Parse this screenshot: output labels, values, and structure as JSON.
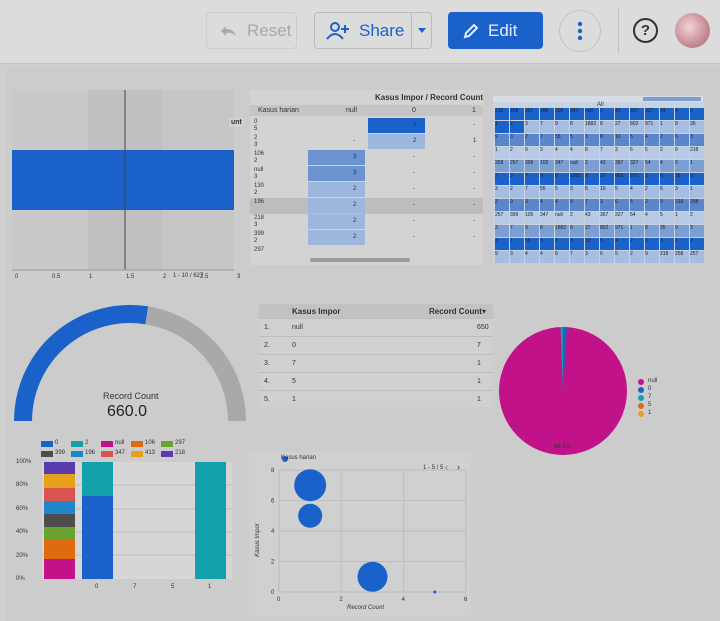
{
  "toolbar": {
    "reset_label": "Reset",
    "share_label": "Share",
    "edit_label": "Edit",
    "help_glyph": "?"
  },
  "colors": {
    "primary_blue": "#1a62c9",
    "magenta": "#c2128a",
    "teal": "#13a0ab",
    "grey_track": "#a9a9a9"
  },
  "icons": [
    "reset-icon",
    "add-person-icon",
    "dropdown-caret-icon",
    "pencil-icon",
    "more-vert-icon",
    "help-icon",
    "avatar"
  ],
  "pivot": {
    "title": "Kasus Impor / Record Count",
    "row_header": "Kasus harian",
    "col_headers": [
      "null",
      "0",
      "1"
    ],
    "rows": [
      {
        "label": "0",
        "sub": "5",
        "vals": [
          "",
          "3",
          "-"
        ]
      },
      {
        "label": "2",
        "sub": "3",
        "vals": [
          "-",
          "2",
          "1"
        ]
      },
      {
        "label": "106",
        "sub": "2",
        "vals": [
          "3",
          "-",
          "-"
        ]
      },
      {
        "label": "null",
        "sub": "3",
        "vals": [
          "3",
          "-",
          "-"
        ]
      },
      {
        "label": "130",
        "sub": "2",
        "vals": [
          "2",
          "-",
          "-"
        ]
      },
      {
        "label": "196",
        "sub": "",
        "vals": [
          "2",
          "-",
          "-"
        ]
      },
      {
        "label": "218",
        "sub": "3",
        "vals": [
          "2",
          "-",
          "-"
        ]
      },
      {
        "label": "399",
        "sub": "2",
        "vals": [
          "2",
          "-",
          "-"
        ]
      },
      {
        "label": "297",
        "sub": "",
        "vals": [
          "",
          "",
          ""
        ]
      }
    ]
  },
  "bar_panel": {
    "side_label": "unt",
    "axis_ticks": [
      "0",
      "0.5",
      "1",
      "1.5",
      "2",
      "2.5",
      "3"
    ],
    "pager": "1 - 10 / 627"
  },
  "treemap": {
    "title": "All",
    "labels": [
      "218",
      "258",
      "257",
      "399",
      "105",
      "347",
      "null",
      "2",
      "43",
      "367",
      "327",
      "54",
      "4",
      "5",
      "1",
      "2",
      "3",
      "7",
      "9",
      "8",
      "1882",
      "8",
      "27",
      "802",
      "971",
      "1",
      "8",
      "35",
      "9",
      "3",
      "2",
      "7",
      "55",
      "5",
      "3",
      "8",
      "10",
      "5",
      "4",
      "2",
      "6",
      "3",
      "1",
      "2",
      "9",
      "3",
      "4",
      "4",
      "8",
      "7",
      "3",
      "6",
      "5",
      "2",
      "9"
    ]
  },
  "gauge": {
    "label": "Record Count",
    "value": "660.0",
    "fraction": 0.55
  },
  "table": {
    "headers": [
      "Kasus Impor",
      "Record Count"
    ],
    "sort_marker": "▾",
    "rows": [
      {
        "idx": "1.",
        "name": "null",
        "count": "650"
      },
      {
        "idx": "2.",
        "name": "0",
        "count": "7"
      },
      {
        "idx": "3.",
        "name": "7",
        "count": "1"
      },
      {
        "idx": "4.",
        "name": "5",
        "count": "1"
      },
      {
        "idx": "5.",
        "name": "1",
        "count": "1"
      }
    ]
  },
  "pie": {
    "label": "98.5%",
    "legend": [
      {
        "label": "null",
        "color": "#c2128a"
      },
      {
        "label": "0",
        "color": "#1a62c9"
      },
      {
        "label": "7",
        "color": "#13a0ab"
      },
      {
        "label": "5",
        "color": "#e06a10"
      },
      {
        "label": "1",
        "color": "#e3a21a"
      }
    ]
  },
  "stacked": {
    "legend": [
      {
        "label": "0",
        "color": "#1a62c9"
      },
      {
        "label": "2",
        "color": "#13a0ab"
      },
      {
        "label": "null",
        "color": "#c2128a"
      },
      {
        "label": "106",
        "color": "#e06a10"
      },
      {
        "label": "297",
        "color": "#6aa231"
      },
      {
        "label": "399",
        "color": "#4d4d4d"
      },
      {
        "label": "196",
        "color": "#1f86c9"
      },
      {
        "label": "347",
        "color": "#d9534f"
      },
      {
        "label": "413",
        "color": "#e3a21a"
      },
      {
        "label": "218",
        "color": "#5b3bb0"
      }
    ],
    "y_ticks": [
      "100%",
      "80%",
      "60%",
      "40%",
      "20%",
      "0%"
    ],
    "x_labels": [
      "0",
      "7",
      "5",
      "1"
    ]
  },
  "chart_data": {
    "type": "scatter",
    "legend": "Kasus harian",
    "pager": "1 - 5 / 5",
    "xlabel": "Record Count",
    "ylabel": "Kasus Impor",
    "xlim": [
      0,
      6
    ],
    "ylim": [
      0,
      8
    ],
    "x_ticks": [
      "0",
      "2",
      "4",
      "6"
    ],
    "y_ticks": [
      "0",
      "2",
      "4",
      "6",
      "8"
    ],
    "points": [
      {
        "x": 1,
        "y": 7,
        "r": 16
      },
      {
        "x": 1,
        "y": 5,
        "r": 12
      },
      {
        "x": 3,
        "y": 1,
        "r": 15
      },
      {
        "x": 5,
        "y": 0,
        "r": 1.5
      }
    ]
  }
}
